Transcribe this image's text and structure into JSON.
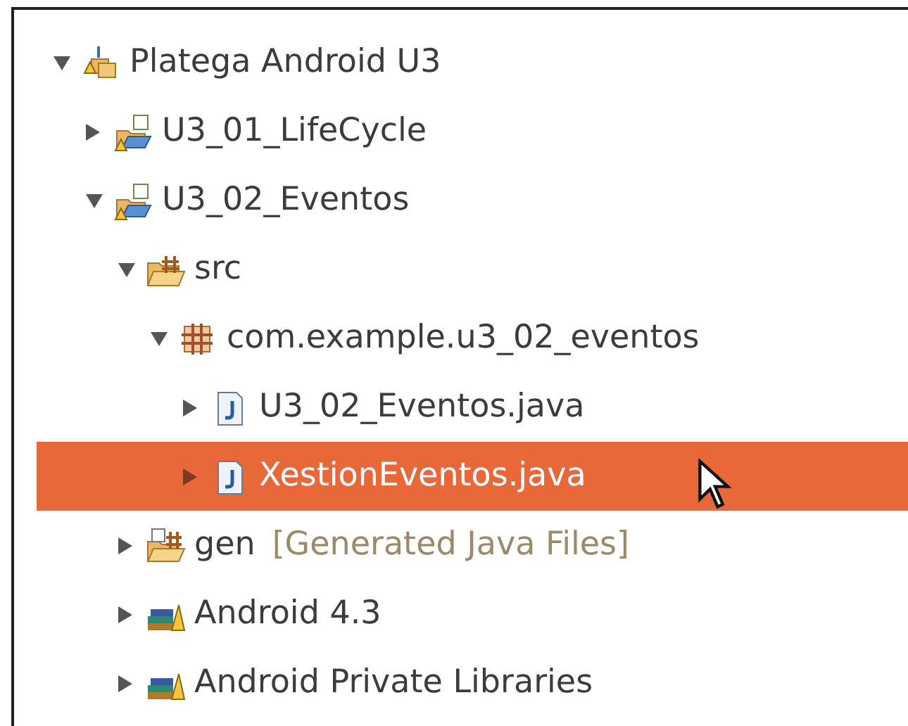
{
  "tree": [
    {
      "label": "Platega Android U3",
      "kind": "working-set",
      "expanded": true,
      "selected": false,
      "children": [
        {
          "label": "U3_01_LifeCycle",
          "kind": "project",
          "expanded": false,
          "selected": false
        },
        {
          "label": "U3_02_Eventos",
          "kind": "project",
          "expanded": true,
          "selected": false,
          "children": [
            {
              "label": "src",
              "kind": "source-folder",
              "expanded": true,
              "selected": false,
              "children": [
                {
                  "label": "com.example.u3_02_eventos",
                  "kind": "package",
                  "expanded": true,
                  "selected": false,
                  "children": [
                    {
                      "label": "U3_02_Eventos.java",
                      "kind": "java-file",
                      "expanded": false,
                      "selected": false
                    },
                    {
                      "label": "XestionEventos.java",
                      "kind": "java-file",
                      "expanded": false,
                      "selected": true
                    }
                  ]
                }
              ]
            },
            {
              "label": "gen",
              "suffix": "[Generated Java Files]",
              "kind": "gen-folder",
              "expanded": false,
              "selected": false
            },
            {
              "label": "Android 4.3",
              "kind": "library",
              "expanded": false,
              "selected": false
            },
            {
              "label": "Android Private Libraries",
              "kind": "library",
              "expanded": false,
              "selected": false
            }
          ]
        }
      ]
    }
  ]
}
